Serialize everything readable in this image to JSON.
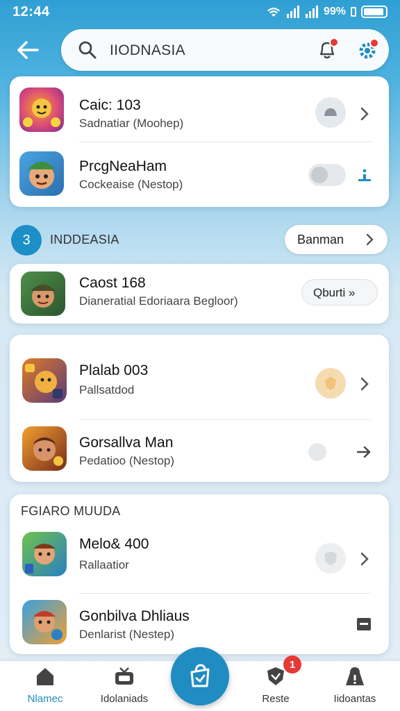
{
  "status_bar": {
    "time": "12:44",
    "battery": "99%"
  },
  "search": {
    "query": "IIODNASIA"
  },
  "top_card": {
    "rows": [
      {
        "title": "Caic: 103",
        "subtitle": "Sadnatiar (Moohep)",
        "icon": "game-thumbnail-1"
      },
      {
        "title": "PrcgNeaHam",
        "subtitle": "Cockeaise (Nestop)",
        "icon": "game-thumbnail-2"
      }
    ]
  },
  "section": {
    "number": "3",
    "title": "INDDEASIA",
    "button_label": "Banman"
  },
  "single_card": {
    "title": "Caost 168",
    "subtitle": "Dianeratial Edoriaara Begloor)",
    "button_label": "Qburti »"
  },
  "middle_card": {
    "rows": [
      {
        "title": "Plalab 003",
        "subtitle": "Pallsatdod",
        "icon": "game-thumbnail-3"
      },
      {
        "title": "Gorsallva Man",
        "subtitle": "Pedatioo (Nestop)",
        "icon": "game-thumbnail-4"
      }
    ]
  },
  "bottom_card": {
    "heading": "FGIARO MUUDA",
    "rows": [
      {
        "title": "Melo& 400",
        "subtitle": "Rallaatior",
        "icon": "game-thumbnail-5"
      },
      {
        "title": "Gonbilva Dhliaus",
        "subtitle": "Denlarist (Nestep)",
        "icon": "game-thumbnail-6"
      }
    ]
  },
  "bottom_nav": {
    "items": [
      {
        "label": "Nlamec",
        "icon": "home-icon"
      },
      {
        "label": "Idolaniads",
        "icon": "tv-icon"
      },
      {
        "label": "Reste",
        "icon": "shield-icon",
        "badge": "1"
      },
      {
        "label": "Iidoantas",
        "icon": "profile-icon"
      }
    ],
    "fab_icon": "bag-icon"
  },
  "colors": {
    "accent": "#1f8cc2",
    "badge": "#e53935"
  }
}
